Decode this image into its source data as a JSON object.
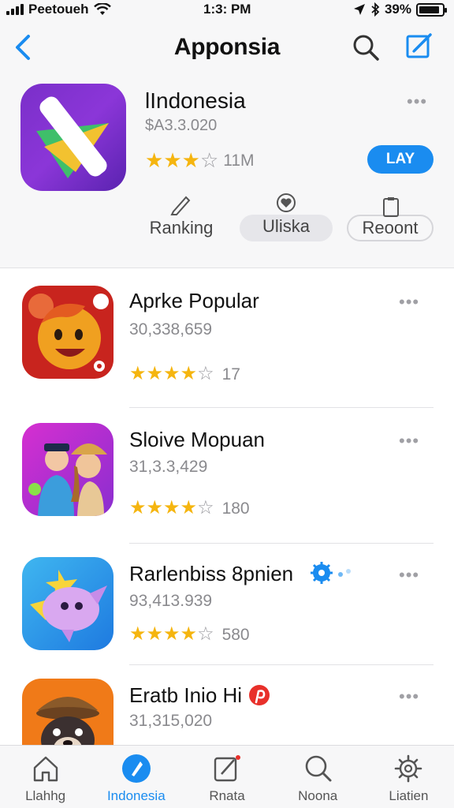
{
  "status_bar": {
    "carrier": "Peetoueh",
    "time": "1:3: PM",
    "battery": "39%"
  },
  "nav": {
    "title": "Apponsia"
  },
  "featured": {
    "title": "lIndonesia",
    "price": "$A3.3.020",
    "rating_stars": 3,
    "count": "11M",
    "get_label": "LAY",
    "segments": [
      "Ranking",
      "Uliska",
      "Reoont"
    ]
  },
  "apps": [
    {
      "title": "Aprke Popular",
      "subtitle": "30,338,659",
      "rating_stars": 4,
      "count": "17"
    },
    {
      "title": "Sloive Mopuan",
      "subtitle": "31,3.3,429",
      "rating_stars": 4,
      "count": "180"
    },
    {
      "title": "Rarlenbiss 8pnien",
      "subtitle": "93,413.939",
      "rating_stars": 4,
      "count": "580"
    },
    {
      "title": "Eratb Inio Hi",
      "subtitle": "31,315,020",
      "rating_stars": 0,
      "count": ""
    }
  ],
  "tabs": [
    {
      "label": "Llahhg",
      "icon": "home-icon"
    },
    {
      "label": "Indonesia",
      "icon": "compass-icon"
    },
    {
      "label": "Rnata",
      "icon": "edit-icon"
    },
    {
      "label": "Noona",
      "icon": "search-icon"
    },
    {
      "label": "Liatien",
      "icon": "gear-icon"
    }
  ],
  "colors": {
    "accent": "#1a8cf0",
    "star": "#f5b50f",
    "muted": "#8a8a8e"
  }
}
